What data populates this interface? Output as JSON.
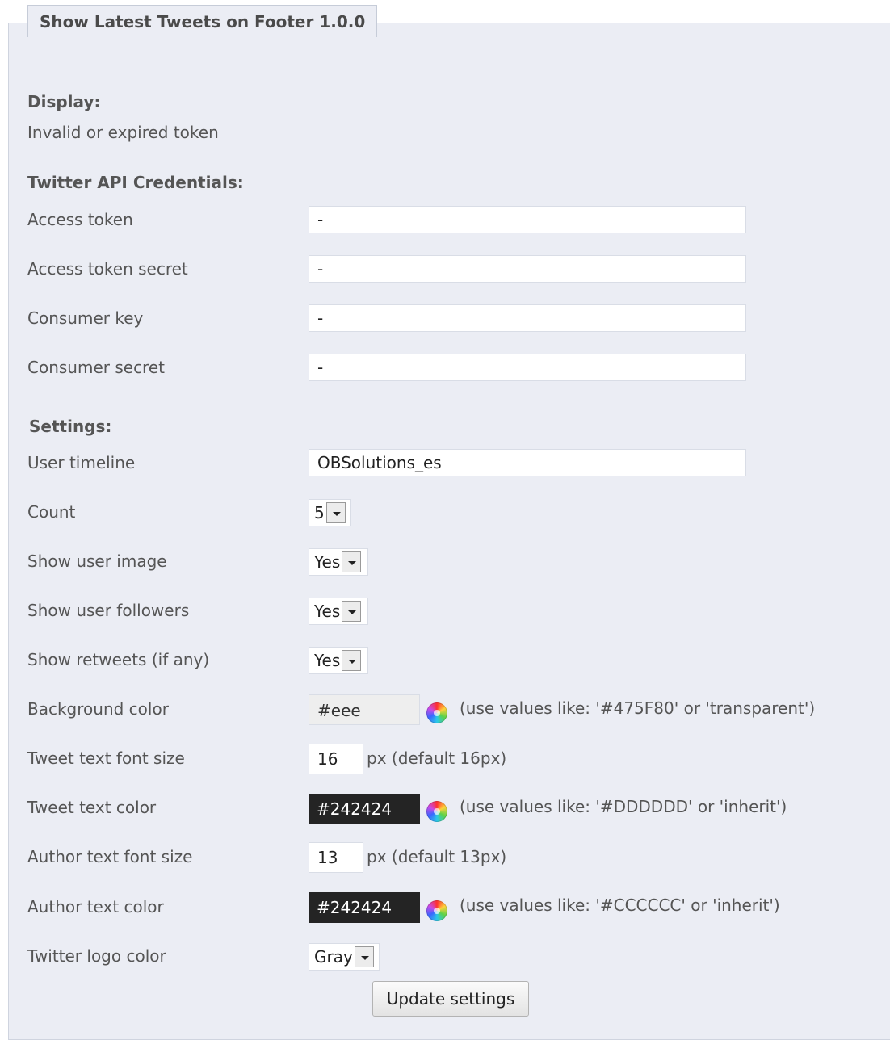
{
  "legend": "Show Latest Tweets on Footer 1.0.0",
  "display": {
    "title": "Display:",
    "message": "Invalid or expired token"
  },
  "credentials": {
    "title": "Twitter API Credentials:",
    "access_token": {
      "label": "Access token",
      "value": "-"
    },
    "access_token_secret": {
      "label": "Access token secret",
      "value": "-"
    },
    "consumer_key": {
      "label": "Consumer key",
      "value": "-"
    },
    "consumer_secret": {
      "label": "Consumer secret",
      "value": "-"
    }
  },
  "settings": {
    "title": "Settings:",
    "user_timeline": {
      "label": "User timeline",
      "value": "OBSolutions_es"
    },
    "count": {
      "label": "Count",
      "value": "5"
    },
    "show_user_image": {
      "label": "Show user image",
      "value": "Yes"
    },
    "show_user_followers": {
      "label": "Show user followers",
      "value": "Yes"
    },
    "show_retweets": {
      "label": "Show retweets (if any)",
      "value": "Yes"
    },
    "background_color": {
      "label": "Background color",
      "value": "#eee",
      "hint": "(use values like: '#475F80' or 'transparent')",
      "swatch": "#eeeeee"
    },
    "tweet_font_size": {
      "label": "Tweet text font size",
      "value": "16",
      "hint": "px (default 16px)"
    },
    "tweet_text_color": {
      "label": "Tweet text color",
      "value": "#242424",
      "hint": "(use values like: '#DDDDDD' or 'inherit')",
      "swatch": "#242424"
    },
    "author_font_size": {
      "label": "Author text font size",
      "value": "13",
      "hint": "px (default 13px)"
    },
    "author_text_color": {
      "label": "Author text color",
      "value": "#242424",
      "hint": "(use values like: '#CCCCCC' or 'inherit')",
      "swatch": "#242424"
    },
    "twitter_logo_color": {
      "label": "Twitter logo color",
      "value": "Gray"
    }
  },
  "update_button": "Update settings",
  "icons": {
    "color_picker": "color-wheel-icon",
    "dropdown": "chevron-down-icon"
  }
}
